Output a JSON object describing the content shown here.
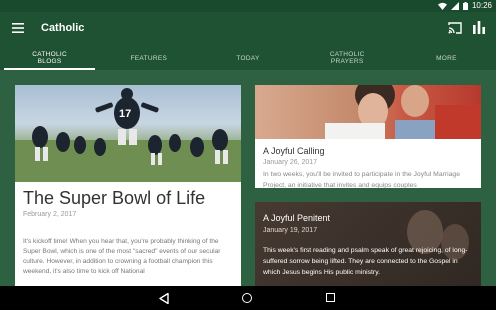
{
  "status": {
    "time": "10:26"
  },
  "app": {
    "title": "Catholic"
  },
  "tabs": [
    {
      "label_line1": "CATHOLIC",
      "label_line2": "BLOGS",
      "active": true
    },
    {
      "label_line1": "FEATURES",
      "label_line2": "",
      "active": false
    },
    {
      "label_line1": "TODAY",
      "label_line2": "",
      "active": false
    },
    {
      "label_line1": "CATHOLIC",
      "label_line2": "PRAYERS",
      "active": false
    },
    {
      "label_line1": "MORE",
      "label_line2": "",
      "active": false
    }
  ],
  "cards": {
    "main": {
      "title": "The Super Bowl of Life",
      "date": "February 2, 2017",
      "excerpt": "It's kickoff time! When you hear that, you're probably thinking of the Super Bowl, which is one of the most \"sacred\" events of our secular culture. However, in addition to crowning a football champion this weekend, it's also time to kick off National",
      "jersey_number": "17"
    },
    "calling": {
      "title": "A Joyful Calling",
      "date": "January 26, 2017",
      "excerpt": "In two weeks, you'll be invited to participate in the Joyful Marriage Project, an initiative that invites and equips couples"
    },
    "penitent": {
      "title": "A Joyful Penitent",
      "date": "January 19, 2017",
      "excerpt": "This week's first reading and psalm speak of great rejoicing, of long-suffered sorrow being lifted. They are connected to the Gospel in which Jesus begins His public ministry."
    }
  },
  "colors": {
    "primary": "#1f5133",
    "status_bar": "#1a4a2e",
    "background": "#2d6141"
  },
  "icons": [
    "wifi-icon",
    "signal-icon",
    "battery-icon",
    "menu-icon",
    "cast-icon",
    "stats-icon",
    "back-icon",
    "home-icon",
    "recent-apps-icon"
  ]
}
